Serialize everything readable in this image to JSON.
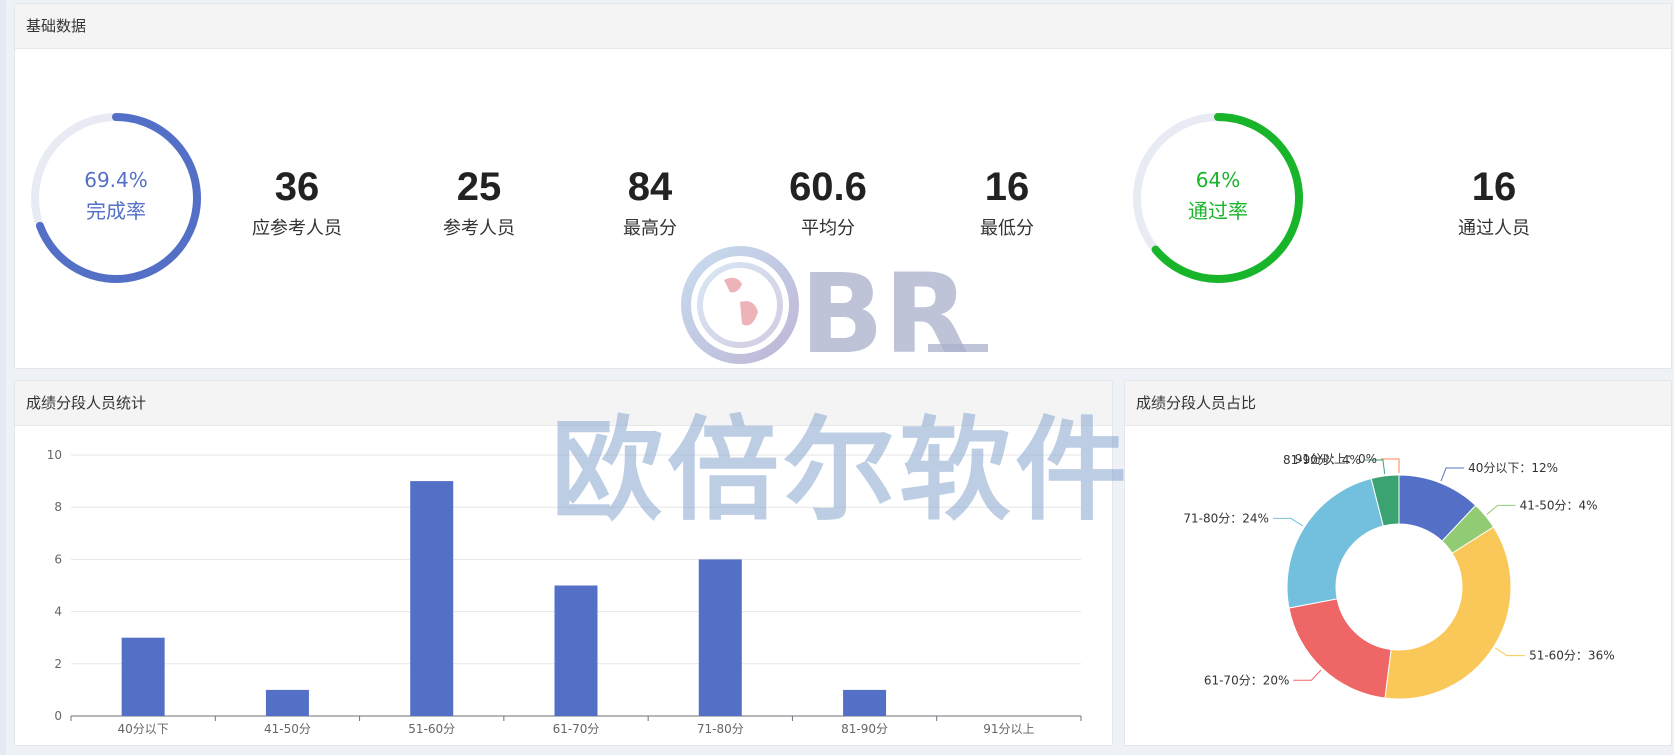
{
  "basic": {
    "title": "基础数据",
    "completion": {
      "percent": 69.4,
      "value_text": "69.4%",
      "label": "完成率",
      "color": "#5470c6"
    },
    "pass": {
      "percent": 64,
      "value_text": "64%",
      "label": "通过率",
      "color": "#18b52a"
    },
    "stats": [
      {
        "value": "36",
        "label": "应参考人员"
      },
      {
        "value": "25",
        "label": "参考人员"
      },
      {
        "value": "84",
        "label": "最高分"
      },
      {
        "value": "60.6",
        "label": "平均分"
      },
      {
        "value": "16",
        "label": "最低分"
      }
    ],
    "pass_people": {
      "value": "16",
      "label": "通过人员"
    }
  },
  "watermark": {
    "logo": "BR",
    "text": "欧倍尔软件"
  },
  "bar_panel": {
    "title": "成绩分段人员统计"
  },
  "pie_panel": {
    "title": "成绩分段人员占比"
  },
  "chart_data": [
    {
      "type": "bar",
      "categories": [
        "40分以下",
        "41-50分",
        "51-60分",
        "61-70分",
        "71-80分",
        "81-90分",
        "91分以上"
      ],
      "values": [
        3,
        1,
        9,
        5,
        6,
        1,
        0
      ],
      "yticks": [
        "0",
        "2",
        "4",
        "6",
        "8",
        "10"
      ],
      "ylim": [
        0,
        10
      ],
      "color": "#5470c6",
      "grid": true
    },
    {
      "type": "pie",
      "donut": true,
      "slices": [
        {
          "label": "40分以下：12%",
          "value": 12,
          "color": "#5470c6"
        },
        {
          "label": "41-50分：4%",
          "value": 4,
          "color": "#91cc75"
        },
        {
          "label": "51-60分：36%",
          "value": 36,
          "color": "#fac858"
        },
        {
          "label": "61-70分：20%",
          "value": 20,
          "color": "#ee6666"
        },
        {
          "label": "71-80分：24%",
          "value": 24,
          "color": "#73c0de"
        },
        {
          "label": "81-90分：4%",
          "value": 4,
          "color": "#3ba272"
        },
        {
          "label": "91分以上：0%",
          "value": 0,
          "color": "#fc8452"
        }
      ]
    }
  ]
}
